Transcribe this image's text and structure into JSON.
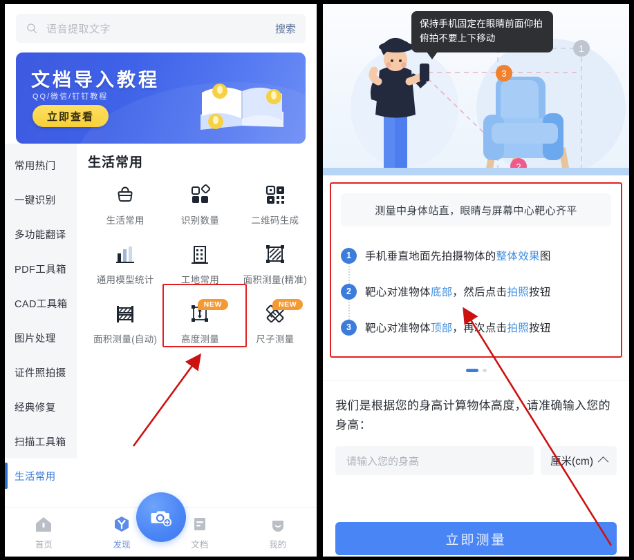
{
  "left_phone": {
    "search": {
      "placeholder": "语音提取文字",
      "button_label": "搜索",
      "icon": "search-icon"
    },
    "banner": {
      "title": "文档导入教程",
      "subtitle": "QQ/微信/钉钉教程",
      "cta_label": "立即查看",
      "art": "open-book-illustration",
      "bg_color": "#3f62e8",
      "cta_color": "#f7cf37"
    },
    "sidebar": {
      "items": [
        {
          "label": "常用热门",
          "active": false
        },
        {
          "label": "一键识别",
          "active": false
        },
        {
          "label": "多功能翻译",
          "active": false
        },
        {
          "label": "PDF工具箱",
          "active": false
        },
        {
          "label": "CAD工具箱",
          "active": false
        },
        {
          "label": "图片处理",
          "active": false
        },
        {
          "label": "证件照拍摄",
          "active": false
        },
        {
          "label": "经典修复",
          "active": false
        },
        {
          "label": "扫描工具箱",
          "active": false
        },
        {
          "label": "生活常用",
          "active": true
        }
      ],
      "active_color": "#3c7ddb"
    },
    "grid": {
      "title": "生活常用",
      "tiles": [
        {
          "label": "生活常用",
          "icon": "basket-icon",
          "badge": ""
        },
        {
          "label": "识别数量",
          "icon": "count-shapes-icon",
          "badge": ""
        },
        {
          "label": "二维码生成",
          "icon": "qrcode-icon",
          "badge": ""
        },
        {
          "label": "通用模型统计",
          "icon": "bar-chart-icon",
          "badge": ""
        },
        {
          "label": "工地常用",
          "icon": "building-icon",
          "badge": ""
        },
        {
          "label": "面积测量(精准)",
          "icon": "area-hatch-icon",
          "badge": ""
        },
        {
          "label": "面积测量(自动)",
          "icon": "area-fence-icon",
          "badge": ""
        },
        {
          "label": "高度测量",
          "icon": "height-measure-icon",
          "badge": "NEW"
        },
        {
          "label": "尺子测量",
          "icon": "ruler-icon",
          "badge": "NEW"
        }
      ],
      "badge_color": "#f59a32",
      "highlight_color": "#e02020"
    },
    "tabbar": {
      "items": [
        {
          "label": "首页",
          "icon": "home-icon",
          "active": false
        },
        {
          "label": "发现",
          "icon": "discover-icon",
          "active": true
        },
        {
          "label": "文档",
          "icon": "document-icon",
          "active": false
        },
        {
          "label": "我的",
          "icon": "profile-icon",
          "active": false
        }
      ],
      "fab": {
        "icon": "camera-plus-icon",
        "color": "#4a85f5"
      }
    }
  },
  "right_phone": {
    "illustration": {
      "tooltip": "保持手机固定在眼睛前面仰拍俯拍不要上下移动",
      "markers": [
        {
          "label": "1",
          "color": "#bfc6cf"
        },
        {
          "label": "2",
          "color": "#ef5a8c"
        },
        {
          "label": "3",
          "color": "#f0812e"
        }
      ],
      "alt": "person-holding-phone-measuring-armchair"
    },
    "guide": {
      "headline": "测量中身体站直，眼睛与屏幕中心靶心齐平",
      "steps": [
        {
          "num": "1",
          "prefix": "手机垂直地面先拍摄物体的",
          "highlight": "整体效果",
          "suffix": "图"
        },
        {
          "num": "2",
          "prefix": "靶心对准物体",
          "highlight": "底部",
          "mid": "，然后点击",
          "highlight2": "拍照",
          "suffix": "按钮"
        },
        {
          "num": "3",
          "prefix": "靶心对准物体",
          "highlight": "顶部",
          "mid": "，再次点击",
          "highlight2": "拍照",
          "suffix": "按钮"
        }
      ],
      "highlight_color": "#3c8de0",
      "box_color": "#e02020"
    },
    "pager": {
      "total": 2,
      "current": 1
    },
    "height_section": {
      "question": "我们是根据您的身高计算物体高度，请准确输入您的身高：",
      "input_placeholder": "请输入您的身高",
      "input_value": "",
      "unit_label": "厘米(cm)",
      "unit_caret": "chevron-up-icon"
    },
    "cta": {
      "label": "立即测量",
      "color": "#4a85f5"
    }
  },
  "annotations": {
    "arrows": [
      {
        "name": "arrow-to-height-measure-tile",
        "color": "#cc1111"
      },
      {
        "name": "arrow-to-step2-bottom",
        "color": "#cc1111"
      }
    ]
  }
}
